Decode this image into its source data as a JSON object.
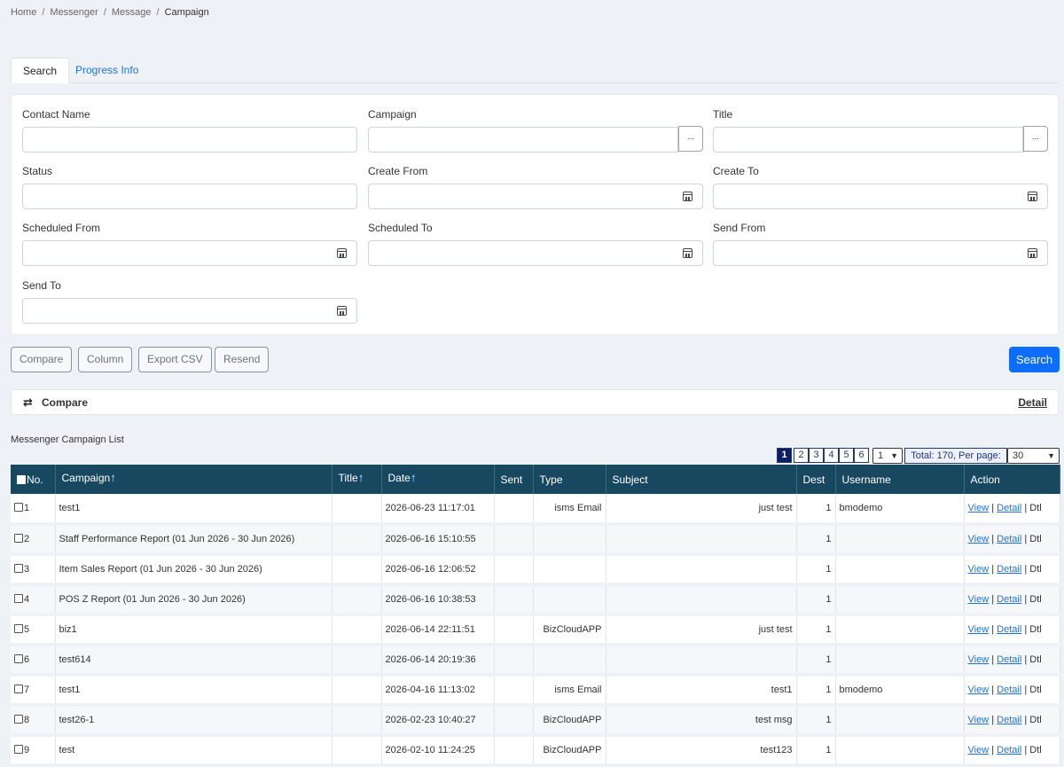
{
  "breadcrumb": [
    "Home",
    "Messenger",
    "Message",
    "Campaign"
  ],
  "tabs": [
    {
      "label": "Search"
    },
    {
      "label": "Progress Info"
    }
  ],
  "form": {
    "contact_name": "Contact Name",
    "campaign": "Campaign",
    "title": "Title",
    "status": "Status",
    "create_from": "Create From",
    "create_to": "Create To",
    "scheduled_from": "Scheduled From",
    "scheduled_to": "Scheduled To",
    "send_from": "Send From",
    "send_to": "Send To",
    "lookup": "..."
  },
  "actions": {
    "compare": "Compare",
    "column": "Column",
    "export_csv": "Export CSV",
    "resend": "Resend",
    "search": "Search"
  },
  "compare_bar": {
    "icon": "swap-icon",
    "title": "Compare",
    "detail": "Detail"
  },
  "list_title": "Messenger Campaign List",
  "pager": {
    "pages": [
      "1",
      "2",
      "3",
      "4",
      "5",
      "6"
    ],
    "current": "1",
    "total": "Total: 170, Per page:",
    "per_page": "30"
  },
  "table": {
    "headers": [
      "No.",
      "Campaign",
      "Title",
      "Date",
      "Sent",
      "Type",
      "Subject",
      "Dest",
      "Username",
      "Action"
    ],
    "rows": [
      {
        "no": "1",
        "campaign": "test1",
        "title": "",
        "date": "2026-06-23 11:17:01",
        "sent": "",
        "type": "isms Email",
        "subject": "just test",
        "dest": "1",
        "username": "bmodemo"
      },
      {
        "no": "2",
        "campaign": "Staff Performance Report (01 Jun 2026 - 30 Jun 2026)",
        "title": "",
        "date": "2026-06-16 15:10:55",
        "sent": "",
        "type": "",
        "subject": "",
        "dest": "1",
        "username": ""
      },
      {
        "no": "3",
        "campaign": "Item Sales Report (01 Jun 2026 - 30 Jun 2026)",
        "title": "",
        "date": "2026-06-16 12:06:52",
        "sent": "",
        "type": "",
        "subject": "",
        "dest": "1",
        "username": ""
      },
      {
        "no": "4",
        "campaign": "POS Z Report (01 Jun 2026 - 30 Jun 2026)",
        "title": "",
        "date": "2026-06-16 10:38:53",
        "sent": "",
        "type": "",
        "subject": "",
        "dest": "1",
        "username": ""
      },
      {
        "no": "5",
        "campaign": "biz1",
        "title": "",
        "date": "2026-06-14 22:11:51",
        "sent": "",
        "type": "BizCloudAPP",
        "subject": "just test",
        "dest": "1",
        "username": ""
      },
      {
        "no": "6",
        "campaign": "test614",
        "title": "",
        "date": "2026-06-14 20:19:36",
        "sent": "",
        "type": "",
        "subject": "",
        "dest": "1",
        "username": ""
      },
      {
        "no": "7",
        "campaign": "test1",
        "title": "",
        "date": "2026-04-16 11:13:02",
        "sent": "",
        "type": "isms Email",
        "subject": "test1",
        "dest": "1",
        "username": "bmodemo"
      },
      {
        "no": "8",
        "campaign": "test26-1",
        "title": "",
        "date": "2026-02-23 10:40:27",
        "sent": "",
        "type": "BizCloudAPP",
        "subject": "test msg",
        "dest": "1",
        "username": ""
      },
      {
        "no": "9",
        "campaign": "test",
        "title": "",
        "date": "2026-02-10 11:24:25",
        "sent": "",
        "type": "BizCloudAPP",
        "subject": "test123",
        "dest": "1",
        "username": ""
      }
    ],
    "action": {
      "view": "View",
      "detail": "Detail",
      "dtl": "Dtl",
      "sep": "|"
    }
  }
}
